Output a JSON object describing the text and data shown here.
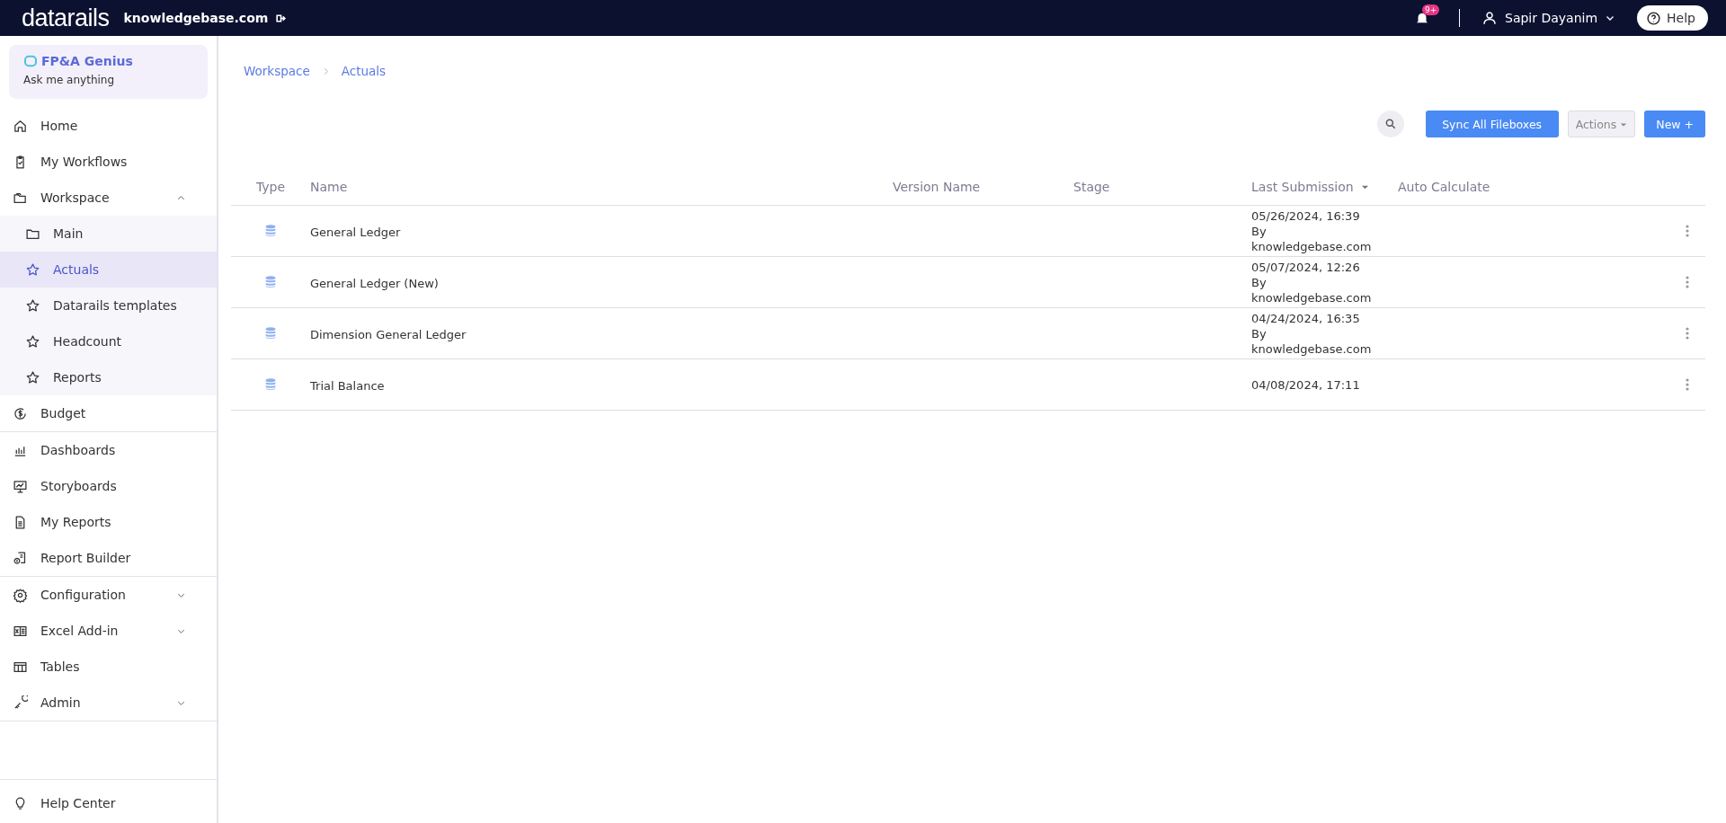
{
  "top_bar": {
    "logo": "datarails",
    "company": "knowledgebase.com",
    "notification_badge": "9+",
    "user": "Sapir Dayanim",
    "help": "Help"
  },
  "genius": {
    "title": "FP&A Genius",
    "subtitle": "Ask me anything"
  },
  "sidebar": {
    "groups": [
      {
        "items": [
          {
            "label": "Home",
            "selected": false
          },
          {
            "label": "My Workflows",
            "selected": false
          },
          {
            "label": "Workspace",
            "selected": false,
            "expanded": true,
            "children": [
              {
                "label": "Main",
                "selected": false
              },
              {
                "label": "Actuals",
                "selected": true
              },
              {
                "label": "Datarails templates",
                "selected": false
              },
              {
                "label": "Headcount",
                "selected": false
              },
              {
                "label": "Reports",
                "selected": false
              }
            ]
          },
          {
            "label": "Budget",
            "selected": false
          }
        ]
      },
      {
        "items": [
          {
            "label": "Dashboards",
            "selected": false
          },
          {
            "label": "Storyboards",
            "selected": false
          },
          {
            "label": "My Reports",
            "selected": false
          },
          {
            "label": "Report Builder",
            "selected": false
          }
        ]
      },
      {
        "items": [
          {
            "label": "Configuration",
            "selected": false,
            "expanded": false
          },
          {
            "label": "Excel Add-in",
            "selected": false,
            "expanded": false
          },
          {
            "label": "Tables",
            "selected": false
          },
          {
            "label": "Admin",
            "selected": false,
            "expanded": false
          }
        ]
      }
    ],
    "footer": {
      "label": "Help Center"
    }
  },
  "breadcrumb": [
    "Workspace",
    "Actuals"
  ],
  "toolbar": {
    "sync": "Sync All Fileboxes",
    "actions": "Actions",
    "new": "New +"
  },
  "table": {
    "columns": [
      "Type",
      "Name",
      "Version Name",
      "Stage",
      "Last Submission",
      "Auto Calculate"
    ],
    "rows": [
      {
        "name": "General Ledger",
        "last_submission": [
          "05/26/2024, 16:39",
          "By",
          "knowledgebase.com"
        ]
      },
      {
        "name": "General Ledger (New)",
        "last_submission": [
          "05/07/2024, 12:26",
          "By",
          "knowledgebase.com"
        ]
      },
      {
        "name": "Dimension General Ledger",
        "last_submission": [
          "04/24/2024, 16:35",
          "By",
          "knowledgebase.com"
        ]
      },
      {
        "name": "Trial Balance",
        "last_submission": [
          "04/08/2024, 17:11"
        ]
      }
    ]
  }
}
